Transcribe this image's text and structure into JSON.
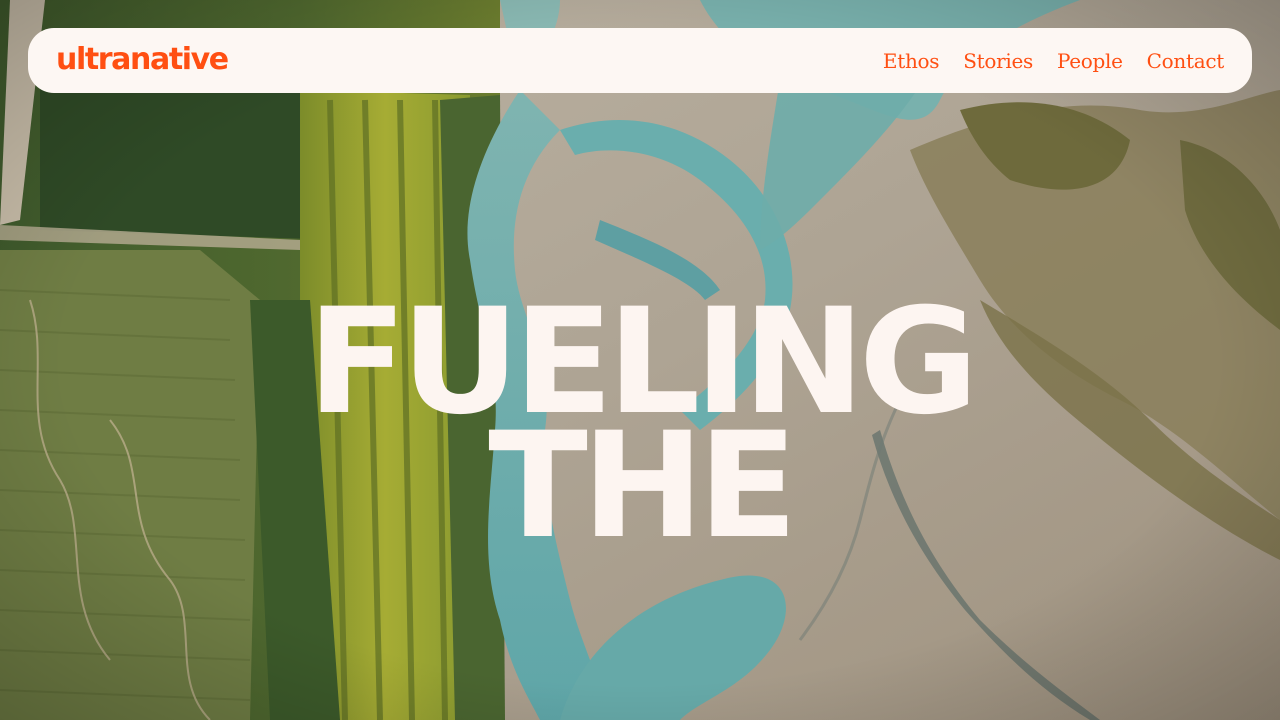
{
  "nav": {
    "logo": "ultranative",
    "links": [
      "Ethos",
      "Stories",
      "People",
      "Contact"
    ]
  },
  "hero": {
    "headline_lines": [
      "FUELING",
      "THE"
    ],
    "image": "aerial-braided-river-landscape"
  },
  "colors": {
    "brand_orange": "#ff4f12",
    "nav_background": "#fdf7f3",
    "headline_text": "#fdf5f1"
  }
}
